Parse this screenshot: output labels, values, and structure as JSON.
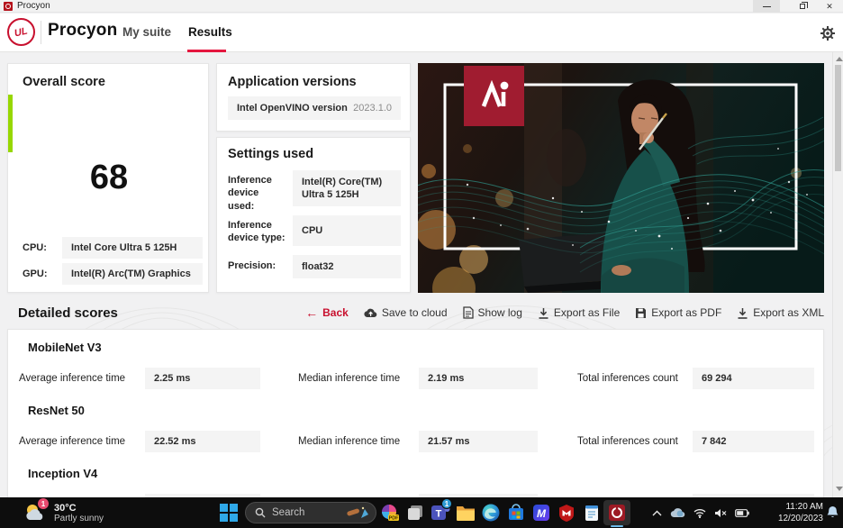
{
  "colors": {
    "brand_red": "#c8102e",
    "results_underline": "#e5173f",
    "score_green": "#97d700",
    "badge_red": "#a01c30",
    "taskbar": "#0d0d0d"
  },
  "title_bar": {
    "app_name": "Procyon"
  },
  "nav": {
    "logo_text": "UL",
    "brand": "Procyon",
    "items": [
      {
        "label": "My suite"
      },
      {
        "label": "Results"
      }
    ]
  },
  "overall": {
    "title": "Overall score",
    "score": "68",
    "rows": [
      {
        "label": "CPU:",
        "value": "Intel Core Ultra 5 125H"
      },
      {
        "label": "GPU:",
        "value": "Intel(R) Arc(TM) Graphics"
      }
    ]
  },
  "app_versions": {
    "title": "Application versions",
    "rows": [
      {
        "label": "Intel OpenVINO version",
        "value": "2023.1.0"
      }
    ]
  },
  "settings": {
    "title": "Settings used",
    "rows": [
      {
        "label": "Inference device used:",
        "value": "Intel(R) Core(TM) Ultra 5 125H"
      },
      {
        "label": "Inference device type:",
        "value": "CPU"
      },
      {
        "label": "Precision:",
        "value": "float32"
      }
    ]
  },
  "actions": {
    "back": "Back",
    "save_cloud": "Save to cloud",
    "show_log": "Show log",
    "export_file": "Export as File",
    "export_pdf": "Export as PDF",
    "export_xml": "Export as XML"
  },
  "detailed": {
    "title": "Detailed scores",
    "metric_labels": {
      "avg": "Average inference time",
      "median": "Median inference time",
      "count": "Total inferences count"
    },
    "models": [
      {
        "name": "MobileNet V3",
        "avg": "2.25 ms",
        "median": "2.19 ms",
        "count": "69 294"
      },
      {
        "name": "ResNet 50",
        "avg": "22.52 ms",
        "median": "21.57 ms",
        "count": "7 842"
      },
      {
        "name": "Inception V4",
        "avg": "",
        "median": "",
        "count": ""
      }
    ]
  },
  "taskbar": {
    "weather": {
      "temp": "30°C",
      "condition": "Partly sunny",
      "badge": "1"
    },
    "search_label": "Search",
    "teams_badge": "1",
    "pdf_badge": "PDF",
    "clock": {
      "time": "11:20 AM",
      "date": "12/20/2023"
    }
  }
}
